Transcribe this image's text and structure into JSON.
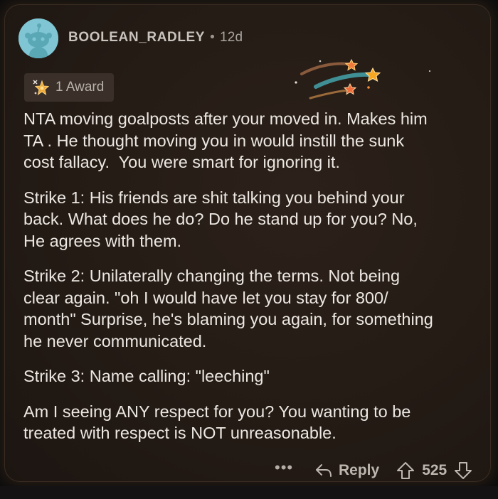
{
  "comment": {
    "username": "BOOLEAN_RADLEY",
    "separator": "•",
    "age": "12d",
    "award_label": "1 Award",
    "paragraphs": [
      "NTA moving goalposts after your moved in. Makes him\nTA . He thought moving you in would instill the sunk\ncost fallacy.  You were smart for ignoring it.",
      "Strike 1: His friends are shit talking you behind your\nback. What does he do? Do he stand up for you? No,\nHe agrees with them.",
      "Strike 2: Unilaterally changing the terms. Not being\nclear again. \"oh I would have let you stay for 800/\nmonth\" Surprise, he's blaming you again, for something\nhe never communicated.",
      "Strike 3: Name calling: \"leeching\"",
      "Am I seeing ANY respect for you? You wanting to be\ntreated with respect is NOT unreasonable."
    ]
  },
  "actions": {
    "more_label": "•••",
    "reply_label": "Reply",
    "score": "525"
  },
  "icons": {
    "avatar": "reddit-snoo-avatar",
    "award": "sparkle-star-icon",
    "comets": "shooting-stars-icon",
    "reply": "reply-arrow-icon",
    "upvote": "upvote-arrow-icon",
    "downvote": "downvote-arrow-icon"
  },
  "colors": {
    "background": "#241b15",
    "text": "#ece7e2",
    "muted": "#bdb6af",
    "avatar": "#7fc5d3"
  }
}
